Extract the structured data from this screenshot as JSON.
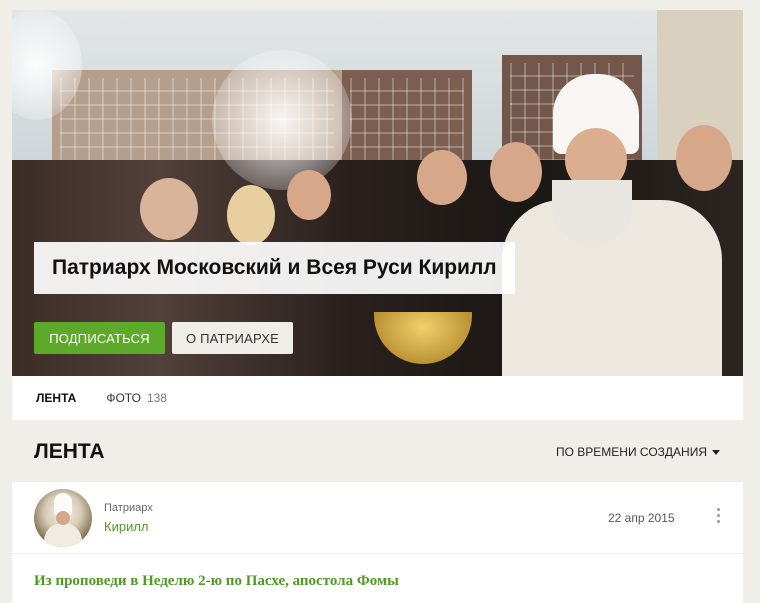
{
  "hero": {
    "title": "Патриарх Московский и Всея Руси Кирилл",
    "subscribe_label": "ПОДПИСАТЬСЯ",
    "about_label": "О ПАТРИАРХЕ"
  },
  "tabs": [
    {
      "label": "ЛЕНТА",
      "count": ""
    },
    {
      "label": "ФОТО",
      "count": "138"
    }
  ],
  "feed": {
    "title": "ЛЕНТА",
    "sort_label": "ПО ВРЕМЕНИ СОЗДАНИЯ"
  },
  "post": {
    "author_role": "Патриарх",
    "author_name": "Кирилл",
    "date": "22 апр 2015",
    "title": "Из проповеди в Неделю 2-ю по Пасхе, апостола Фомы"
  },
  "colors": {
    "accent_green": "#5daa2a",
    "link_green": "#4f9a23",
    "background": "#efeee9"
  }
}
